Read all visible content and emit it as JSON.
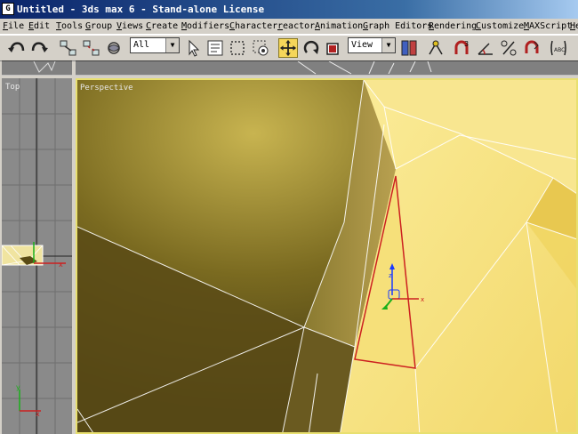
{
  "window": {
    "title": "Untitled - 3ds max 6 - Stand-alone License",
    "app_icon_glyph": "G"
  },
  "menu": [
    "File",
    "Edit",
    "Tools",
    "Group",
    "Views",
    "Create",
    "Modifiers",
    "Character",
    "reactor",
    "Animation",
    "Graph Editors",
    "Rendering",
    "Customize",
    "MAXScript",
    "Help"
  ],
  "toolbar": {
    "selection_filter": "All",
    "reference_coord": "View",
    "snap_label": "3",
    "abc_label": "ABC"
  },
  "viewports": {
    "left": {
      "label": "Top"
    },
    "main": {
      "label": "Perspective"
    }
  },
  "colors": {
    "title_start": "#0a246a",
    "active_border": "#e8e070",
    "selection_red": "#cc2020",
    "gizmo_blue": "#1a3aff",
    "gizmo_green": "#1ab01a",
    "mesh_light": "#f8e690",
    "mesh_dark": "#5a4b14"
  }
}
